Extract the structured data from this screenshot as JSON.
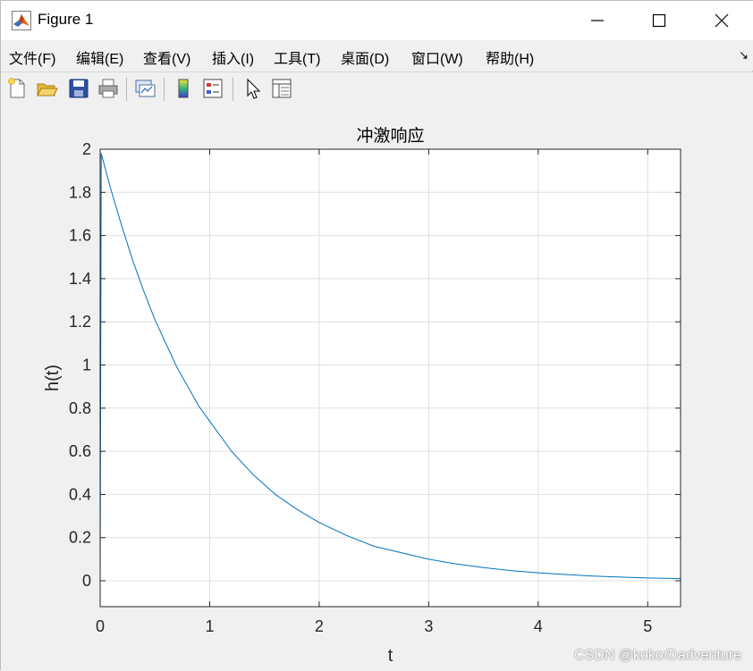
{
  "window": {
    "title": "Figure 1"
  },
  "menu": {
    "items": [
      "文件(F)",
      "编辑(E)",
      "查看(V)",
      "插入(I)",
      "工具(T)",
      "桌面(D)",
      "窗口(W)",
      "帮助(H)"
    ],
    "dock_icon": "dock-arrow-icon"
  },
  "toolbar": {
    "buttons": [
      "new-figure-icon",
      "open-file-icon",
      "save-icon",
      "print-icon",
      "link-plot-icon",
      "colorbar-icon",
      "legend-icon",
      "edit-plot-icon",
      "property-inspector-icon"
    ]
  },
  "colors": {
    "line": "#0072bd",
    "axes_bg": "#ffffff",
    "grid": "#dfdfdf",
    "figure_bg": "#f0f0f0"
  },
  "chart_data": {
    "type": "line",
    "title": "冲激响应",
    "xlabel": "t",
    "ylabel": "h(t)",
    "xlim": [
      0,
      5.3
    ],
    "ylim": [
      -0.12,
      2.0
    ],
    "xticks": [
      0,
      1,
      2,
      3,
      4,
      5
    ],
    "yticks": [
      0,
      0.2,
      0.4,
      0.6,
      0.8,
      1,
      1.2,
      1.4,
      1.6,
      1.8,
      2
    ],
    "ytick_labels": [
      "0",
      "0.2",
      "0.4",
      "0.6",
      "0.8",
      "1",
      "1.2",
      "1.4",
      "1.6",
      "1.8",
      "2"
    ],
    "xtick_labels": [
      "0",
      "1",
      "2",
      "3",
      "4",
      "5"
    ],
    "grid": true,
    "series": [
      {
        "x": [
          0,
          0.01,
          0.02,
          0.1,
          0.2,
          0.3,
          0.4,
          0.5,
          0.6,
          0.7,
          0.8,
          0.9,
          1.0,
          1.2,
          1.4,
          1.6,
          1.8,
          2.0,
          2.25,
          2.5,
          2.75,
          3.0,
          3.25,
          3.5,
          3.75,
          4.0,
          4.25,
          4.5,
          4.75,
          5.0,
          5.3
        ],
        "y": [
          0,
          1.98,
          1.96,
          1.81,
          1.64,
          1.48,
          1.34,
          1.21,
          1.1,
          0.99,
          0.9,
          0.81,
          0.74,
          0.6,
          0.49,
          0.4,
          0.33,
          0.27,
          0.21,
          0.16,
          0.13,
          0.1,
          0.078,
          0.061,
          0.047,
          0.037,
          0.029,
          0.022,
          0.017,
          0.013,
          0.01
        ]
      }
    ]
  },
  "watermark": "CSDN @kokoのadventure"
}
